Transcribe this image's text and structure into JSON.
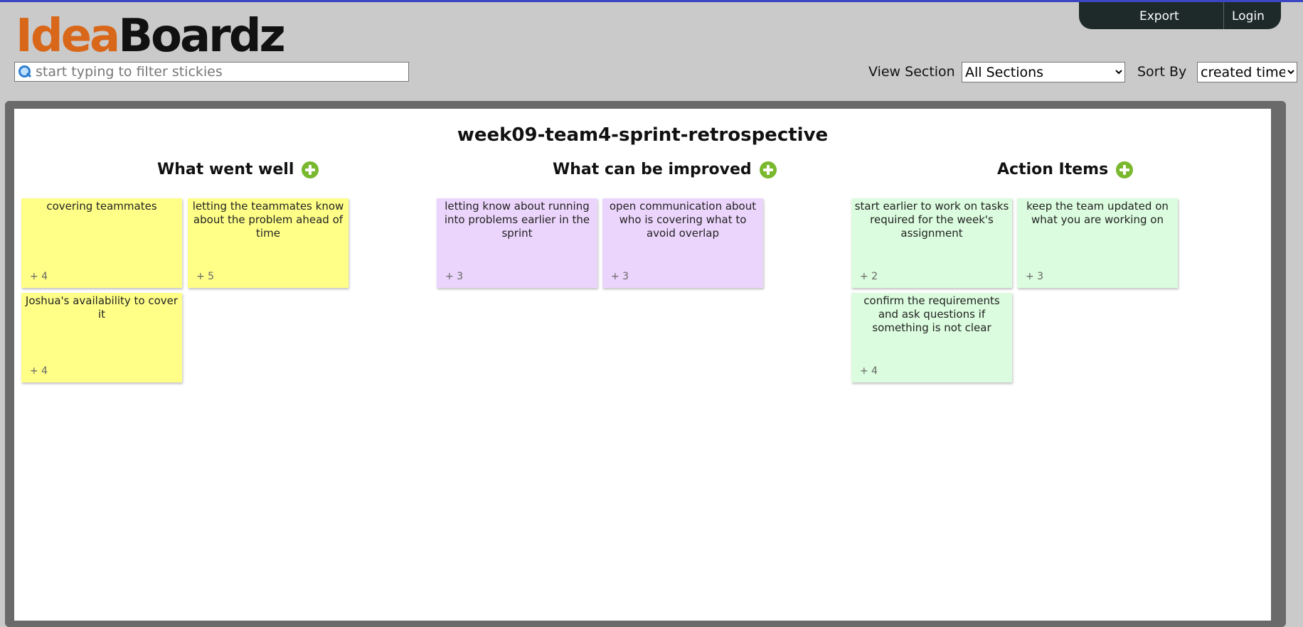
{
  "header": {
    "logo_part1": "Idea",
    "logo_part2": "Boardz",
    "export_label": "Export",
    "login_label": "Login",
    "logo_colors": {
      "idea": "#d8671a",
      "boardz": "#111111"
    }
  },
  "toolbar": {
    "filter_placeholder": "start typing to filter stickies",
    "view_section_label": "View Section",
    "view_section_value": "All Sections",
    "sort_by_label": "Sort By",
    "sort_by_value": "created time"
  },
  "board": {
    "title": "week09-team4-sprint-retrospective",
    "columns": [
      {
        "title": "What went well",
        "color": "#ffff88",
        "stickies": [
          {
            "text": "covering teammates",
            "votes": "+ 4"
          },
          {
            "text": "letting the teammates know about the problem ahead of time",
            "votes": "+ 5"
          },
          {
            "text": "Joshua's availability to cover it",
            "votes": "+ 4"
          }
        ]
      },
      {
        "title": "What can be improved",
        "color": "#ecd5fc",
        "stickies": [
          {
            "text": "letting know about running into problems earlier in the sprint",
            "votes": "+ 3"
          },
          {
            "text": "open communication about who is covering what to avoid overlap",
            "votes": "+ 3"
          }
        ]
      },
      {
        "title": "Action Items",
        "color": "#dbfcde",
        "stickies": [
          {
            "text": "start earlier to work on tasks required for the week's assignment",
            "votes": "+ 2"
          },
          {
            "text": "keep the team updated on what you are working on",
            "votes": "+ 3"
          },
          {
            "text": "confirm the requirements and ask questions if something is not clear",
            "votes": "+ 4"
          }
        ]
      }
    ]
  },
  "accent_colors": {
    "top_border": "#3b46c4",
    "add_button": "#7ab82e",
    "header_bar": "#1e2a2a"
  }
}
